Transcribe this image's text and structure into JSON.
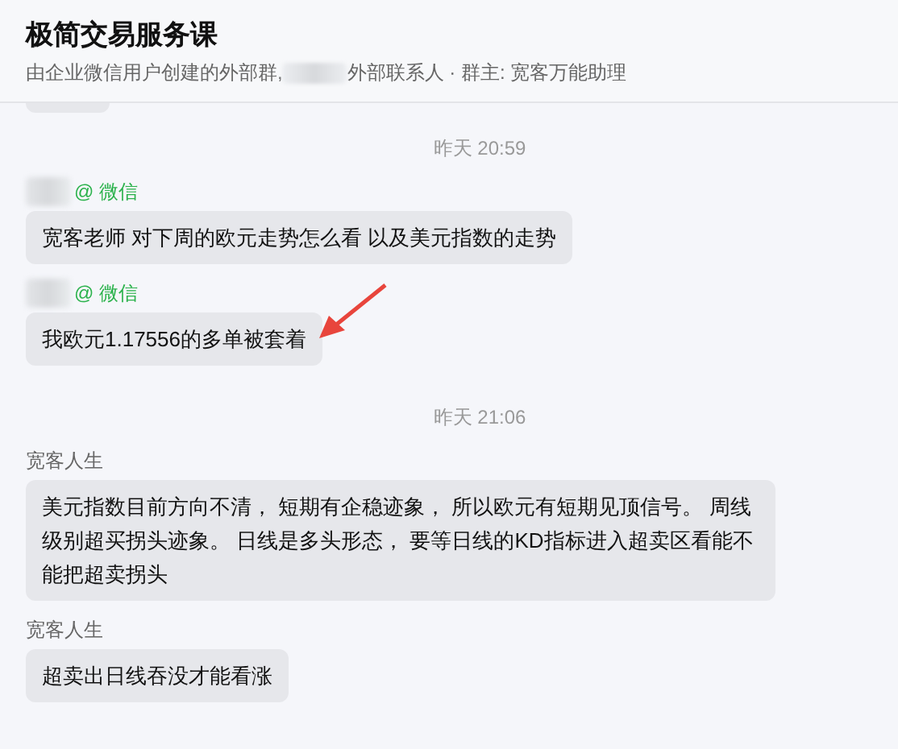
{
  "header": {
    "title": "极简交易服务课",
    "subtitle_before": "由企业微信用户创建的外部群,",
    "subtitle_after": "外部联系人 · 群主: 宽客万能助理"
  },
  "messages": [
    {
      "kind": "cut"
    },
    {
      "kind": "time",
      "text": "昨天 20:59"
    },
    {
      "kind": "message",
      "redacted": true,
      "via": "@ 微信",
      "text": "宽客老师  对下周的欧元走势怎么看  以及美元指数的走势",
      "annotated": false
    },
    {
      "kind": "message",
      "redacted": true,
      "via": "@ 微信",
      "text": "我欧元1.17556的多单被套着",
      "annotated": true
    },
    {
      "kind": "time",
      "text": "昨天 21:06"
    },
    {
      "kind": "message",
      "redacted": false,
      "sender": "宽客人生",
      "text": "美元指数目前方向不清， 短期有企稳迹象， 所以欧元有短期见顶信号。 周线级别超买拐头迹象。 日线是多头形态， 要等日线的KD指标进入超卖区看能不能把超卖拐头",
      "annotated": false
    },
    {
      "kind": "message",
      "redacted": false,
      "sender": "宽客人生",
      "text": "超卖出日线吞没才能看涨",
      "annotated": false
    }
  ]
}
